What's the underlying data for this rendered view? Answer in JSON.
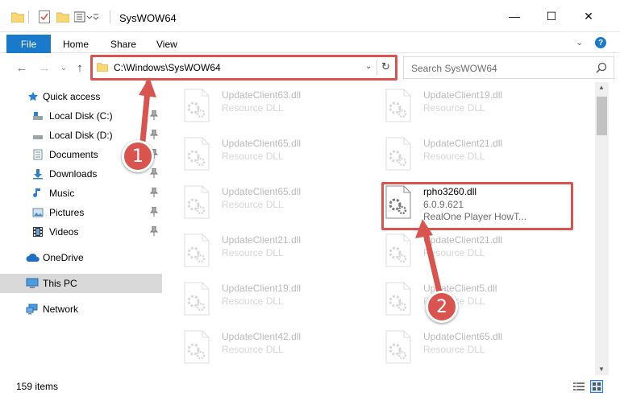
{
  "window": {
    "title": "SysWOW64",
    "minimize": "—",
    "maximize": "☐",
    "close": "✕"
  },
  "ribbon": {
    "tabs": [
      "File",
      "Home",
      "Share",
      "View"
    ],
    "chevron": "⌄",
    "help": "?"
  },
  "nav": {
    "back": "←",
    "forward": "→",
    "recent": "⌄",
    "up": "↑",
    "address": "C:\\Windows\\SysWOW64",
    "address_dropdown": "⌄",
    "refresh": "↻",
    "search_placeholder": "Search SysWOW64"
  },
  "sidebar": {
    "items": [
      {
        "label": "Quick access",
        "icon": "star-icon",
        "pinned": false
      },
      {
        "label": "Local Disk (C:)",
        "icon": "drive-icon",
        "pinned": true
      },
      {
        "label": "Local Disk (D:)",
        "icon": "drive-icon",
        "pinned": true
      },
      {
        "label": "Documents",
        "icon": "documents-icon",
        "pinned": true
      },
      {
        "label": "Downloads",
        "icon": "download-icon",
        "pinned": true
      },
      {
        "label": "Music",
        "icon": "music-icon",
        "pinned": true
      },
      {
        "label": "Pictures",
        "icon": "pictures-icon",
        "pinned": true
      },
      {
        "label": "Videos",
        "icon": "video-icon",
        "pinned": true
      },
      {
        "label": "OneDrive",
        "icon": "cloud-icon",
        "pinned": false
      },
      {
        "label": "This PC",
        "icon": "computer-icon",
        "pinned": false
      },
      {
        "label": "Network",
        "icon": "network-icon",
        "pinned": false
      }
    ]
  },
  "files": [
    {
      "name": "UpdateClient63.dll",
      "type": "Resource DLL",
      "faded": true
    },
    {
      "name": "UpdateClient19.dll",
      "type": "Resource DLL",
      "faded": true
    },
    {
      "name": "UpdateClient65.dll",
      "type": "Resource DLL",
      "faded": true
    },
    {
      "name": "UpdateClient21.dll",
      "type": "Resource DLL",
      "faded": true
    },
    {
      "name": "UpdateClient65.dll",
      "type": "Resource DLL",
      "faded": true
    },
    {
      "name": "rpho3260.dll",
      "version": "6.0.9.621",
      "type": "RealOne Player HowT...",
      "faded": false
    },
    {
      "name": "UpdateClient21.dll",
      "type": "Resource DLL",
      "faded": true
    },
    {
      "name": "UpdateClient21.dll",
      "type": "Resource DLL",
      "faded": true
    },
    {
      "name": "UpdateClient19.dll",
      "type": "Resource DLL",
      "faded": true
    },
    {
      "name": "UpdateClient5.dll",
      "type": "Resource DLL",
      "faded": true
    },
    {
      "name": "UpdateClient42.dll",
      "type": "Resource DLL",
      "faded": true
    },
    {
      "name": "UpdateClient65.dll",
      "type": "Resource DLL",
      "faded": true
    }
  ],
  "status": {
    "item_count": "159 items"
  },
  "annotations": [
    {
      "label": "1"
    },
    {
      "label": "2"
    }
  ],
  "colors": {
    "accent": "#1979ca",
    "highlight": "#d9534f",
    "folder": "#f8d775",
    "selected_bg": "#d9d9d9"
  }
}
